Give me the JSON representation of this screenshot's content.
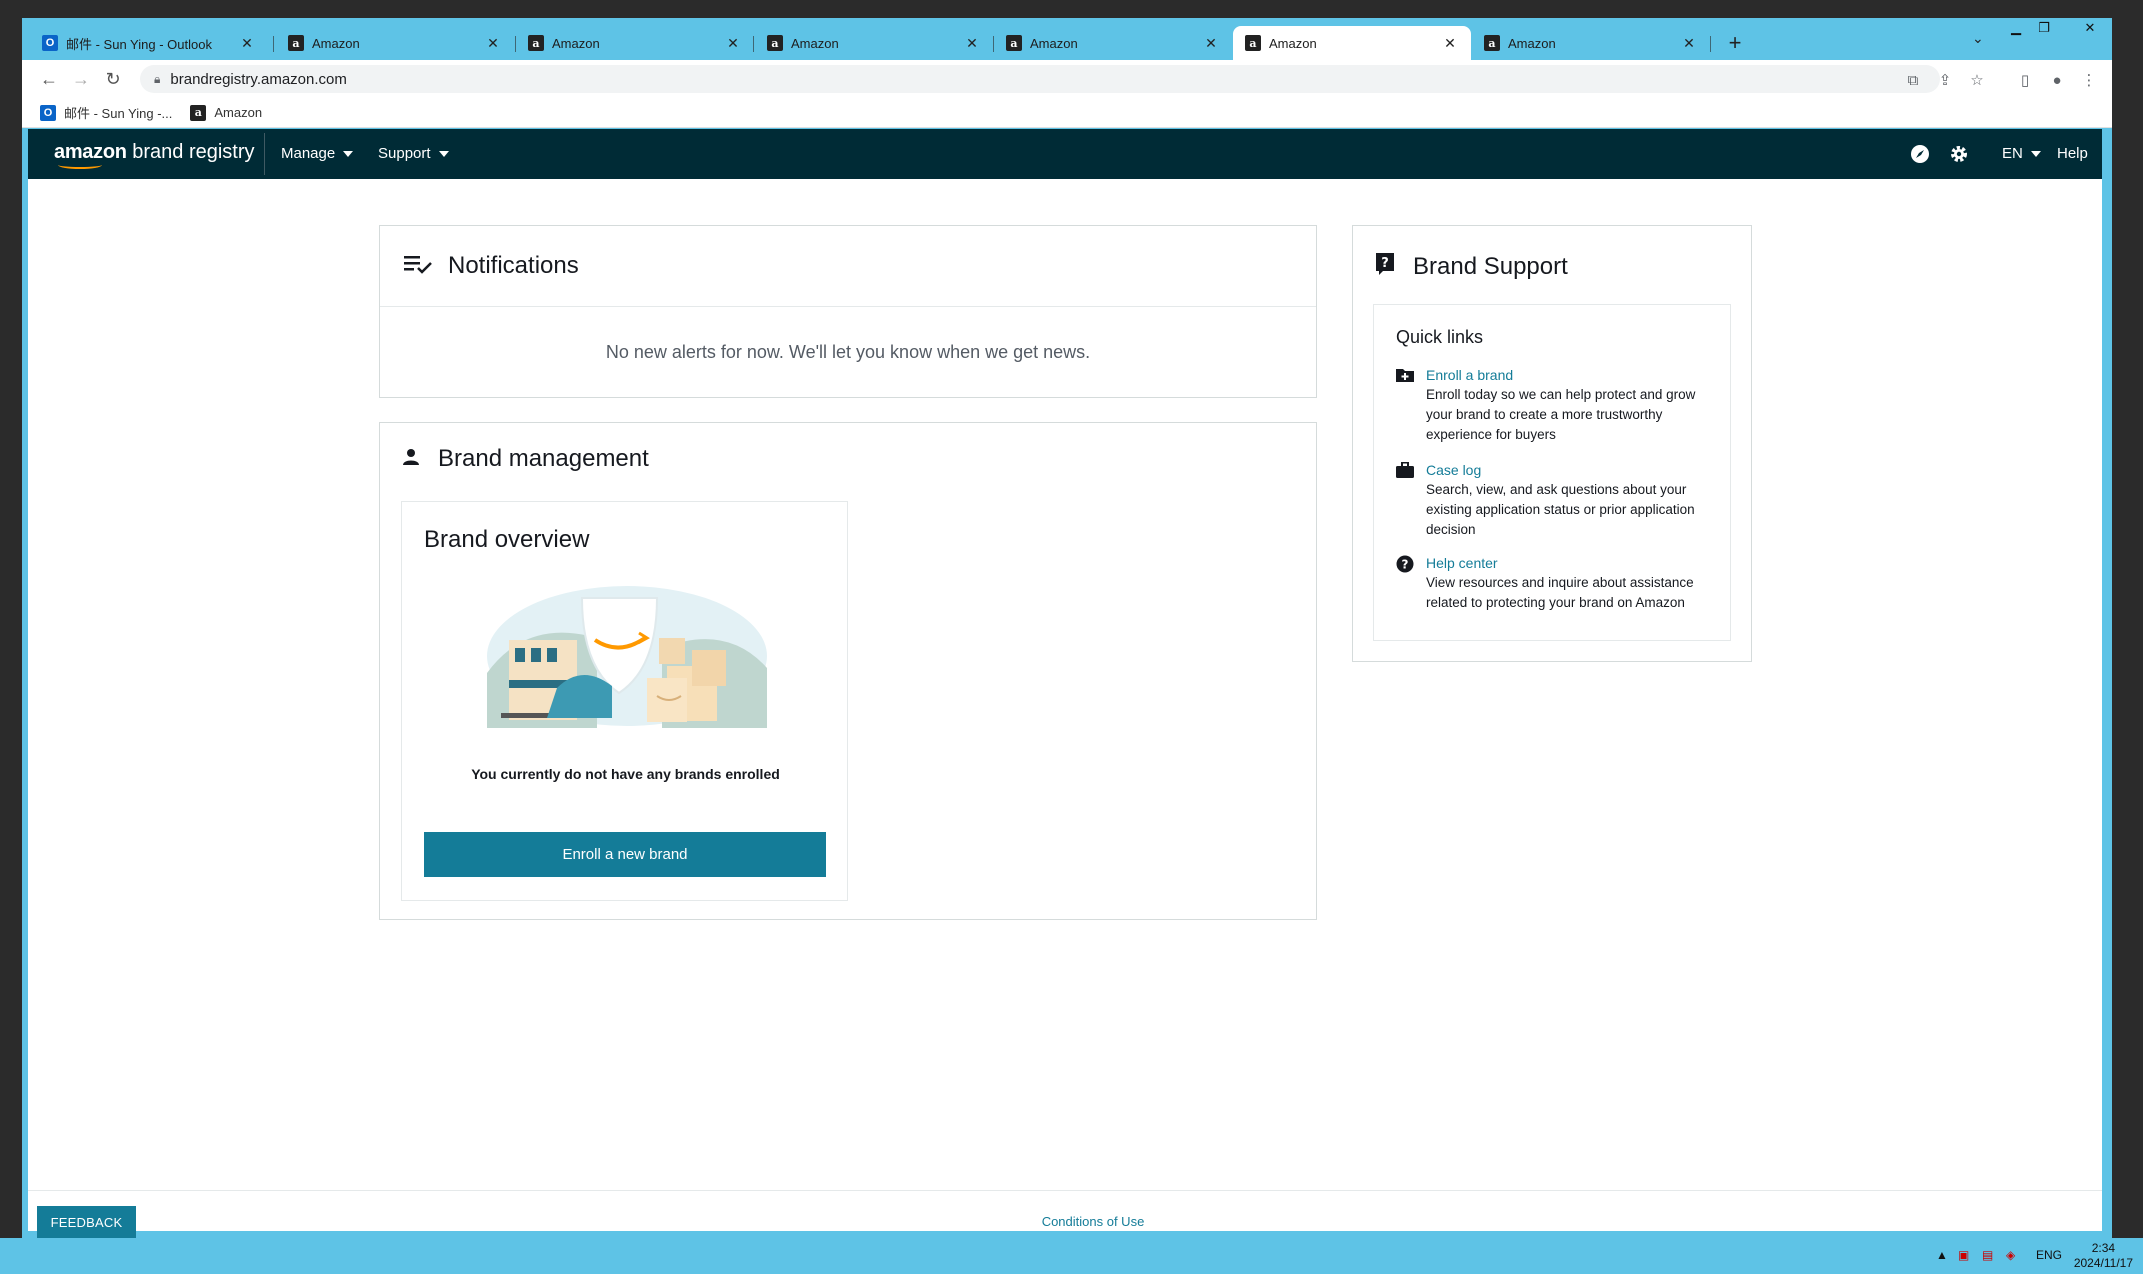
{
  "browser": {
    "tabs": [
      {
        "title": "邮件 - Sun Ying - Outlook",
        "icon": "outlook-icon",
        "active": false
      },
      {
        "title": "Amazon",
        "icon": "amazon-icon",
        "active": false
      },
      {
        "title": "Amazon",
        "icon": "amazon-icon",
        "active": false
      },
      {
        "title": "Amazon",
        "icon": "amazon-icon",
        "active": false
      },
      {
        "title": "Amazon",
        "icon": "amazon-icon",
        "active": false
      },
      {
        "title": "Amazon",
        "icon": "amazon-icon",
        "active": true
      },
      {
        "title": "Amazon",
        "icon": "amazon-icon",
        "active": false
      }
    ],
    "new_tab": "+",
    "url": "brandregistry.amazon.com",
    "bookmarks": [
      {
        "label": "邮件 - Sun Ying -...",
        "icon": "outlook-icon"
      },
      {
        "label": "Amazon",
        "icon": "amazon-icon"
      }
    ]
  },
  "header": {
    "logo_amazon": "amazon",
    "logo_rest": " brand registry",
    "menus": [
      "Manage",
      "Support"
    ],
    "language": "EN",
    "help": "Help"
  },
  "notifications": {
    "title": "Notifications",
    "empty_message": "No new alerts for now. We'll let you know when we get news."
  },
  "brand_management": {
    "title": "Brand management",
    "overview_title": "Brand overview",
    "empty_text": "You currently do not have any brands enrolled",
    "enroll_button": "Enroll a new brand"
  },
  "brand_support": {
    "title": "Brand Support",
    "quick_links_title": "Quick links",
    "links": [
      {
        "label": "Enroll a brand",
        "desc": "Enroll today so we can help protect and grow your brand to create a more trustworthy experience for buyers",
        "icon": "folder-plus-icon"
      },
      {
        "label": "Case log",
        "desc": "Search, view, and ask questions about your existing application status or prior application decision",
        "icon": "briefcase-icon"
      },
      {
        "label": "Help center",
        "desc": "View resources and inquire about assistance related to protecting your brand on Amazon",
        "icon": "question-circle-icon"
      }
    ]
  },
  "footer": {
    "feedback": "FEEDBACK",
    "conditions": "Conditions of Use"
  },
  "taskbar": {
    "lang": "ENG",
    "time": "2:34",
    "date": "2024/11/17"
  },
  "colors": {
    "header_bg": "#002b36",
    "accent": "#147c98",
    "chrome": "#5ec3e6"
  }
}
